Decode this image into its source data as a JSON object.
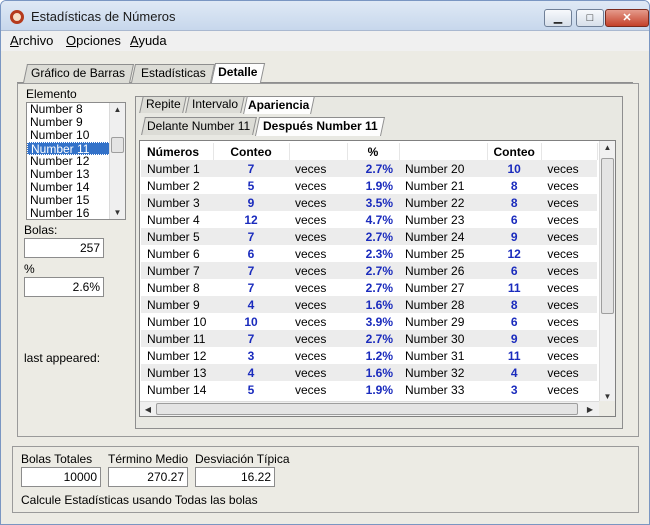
{
  "window": {
    "title": "Estadísticas de Números",
    "minimize": "▁",
    "maximize": "□",
    "close": "✕"
  },
  "menu": [
    {
      "underline": "A",
      "rest": "rchivo"
    },
    {
      "underline": "O",
      "rest": "pciones"
    },
    {
      "underline": "A",
      "rest": "yuda"
    }
  ],
  "top_tabs": [
    "Gráfico de Barras",
    "Estadísticas",
    "Detalle"
  ],
  "left": {
    "element_label": "Elemento",
    "list": [
      "Number 8",
      "Number 9",
      "Number 10",
      "Number 11",
      "Number 12",
      "Number 13",
      "Number 14",
      "Number 15",
      "Number 16"
    ],
    "selected": "Number 11",
    "bolas_label": "Bolas:",
    "bolas_value": "257",
    "pct_label": "%",
    "pct_value": "2.6%",
    "last_appeared_label": "last appeared:"
  },
  "sub_tabs": [
    "Repite",
    "Intervalo",
    "Apariencia"
  ],
  "sub_tabs2": [
    "Delante Number 11",
    "Después Number 11"
  ],
  "table": {
    "headers": [
      "Números",
      "Conteo",
      "",
      "%",
      "",
      "Conteo",
      ""
    ],
    "rows": [
      [
        "Number 1",
        "7",
        "veces",
        "2.7%",
        "Number 20",
        "10",
        "veces"
      ],
      [
        "Number 2",
        "5",
        "veces",
        "1.9%",
        "Number 21",
        "8",
        "veces"
      ],
      [
        "Number 3",
        "9",
        "veces",
        "3.5%",
        "Number 22",
        "8",
        "veces"
      ],
      [
        "Number 4",
        "12",
        "veces",
        "4.7%",
        "Number 23",
        "6",
        "veces"
      ],
      [
        "Number 5",
        "7",
        "veces",
        "2.7%",
        "Number 24",
        "9",
        "veces"
      ],
      [
        "Number 6",
        "6",
        "veces",
        "2.3%",
        "Number 25",
        "12",
        "veces"
      ],
      [
        "Number 7",
        "7",
        "veces",
        "2.7%",
        "Number 26",
        "6",
        "veces"
      ],
      [
        "Number 8",
        "7",
        "veces",
        "2.7%",
        "Number 27",
        "11",
        "veces"
      ],
      [
        "Number 9",
        "4",
        "veces",
        "1.6%",
        "Number 28",
        "8",
        "veces"
      ],
      [
        "Number 10",
        "10",
        "veces",
        "3.9%",
        "Number 29",
        "6",
        "veces"
      ],
      [
        "Number 11",
        "7",
        "veces",
        "2.7%",
        "Number 30",
        "9",
        "veces"
      ],
      [
        "Number 12",
        "3",
        "veces",
        "1.2%",
        "Number 31",
        "11",
        "veces"
      ],
      [
        "Number 13",
        "4",
        "veces",
        "1.6%",
        "Number 32",
        "4",
        "veces"
      ],
      [
        "Number 14",
        "5",
        "veces",
        "1.9%",
        "Number 33",
        "3",
        "veces"
      ]
    ]
  },
  "bottom": {
    "bolas_totales_label": "Bolas Totales",
    "bolas_totales_value": "10000",
    "termino_medio_label": "Término Medio",
    "termino_medio_value": "270.27",
    "desviacion_label": "Desviación Típica",
    "desviacion_value": "16.22",
    "status": "Calcule Estadísticas usando Todas las bolas"
  }
}
